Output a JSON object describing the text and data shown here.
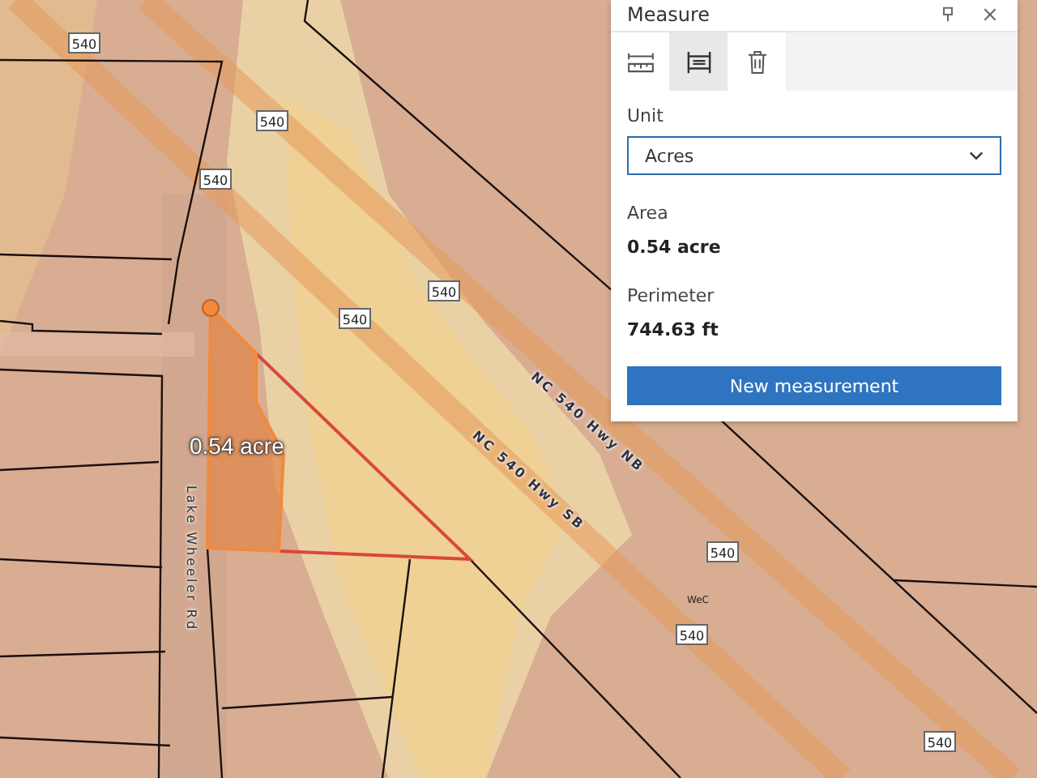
{
  "map": {
    "shields": [
      "540",
      "540",
      "540",
      "540",
      "540",
      "540",
      "540",
      "540"
    ],
    "roads": [
      {
        "kind": "nb",
        "label": "NC 540 Hwy NB"
      },
      {
        "kind": "sb",
        "label": "NC 540 Hwy SB"
      },
      {
        "kind": "street",
        "label": "Lake Wheeler Rd"
      }
    ],
    "soil_label": "WeC",
    "measurement_label": "0.54 acre"
  },
  "panel": {
    "title": "Measure",
    "tools": [
      {
        "kind": "distance",
        "selected": false
      },
      {
        "kind": "area",
        "selected": true
      },
      {
        "kind": "clear",
        "selected": false
      }
    ],
    "unit_label": "Unit",
    "unit_value": "Acres",
    "results": [
      {
        "label": "Area",
        "value": "0.54 acre"
      },
      {
        "label": "Perimeter",
        "value": "744.63 ft"
      }
    ],
    "button": "New measurement"
  }
}
